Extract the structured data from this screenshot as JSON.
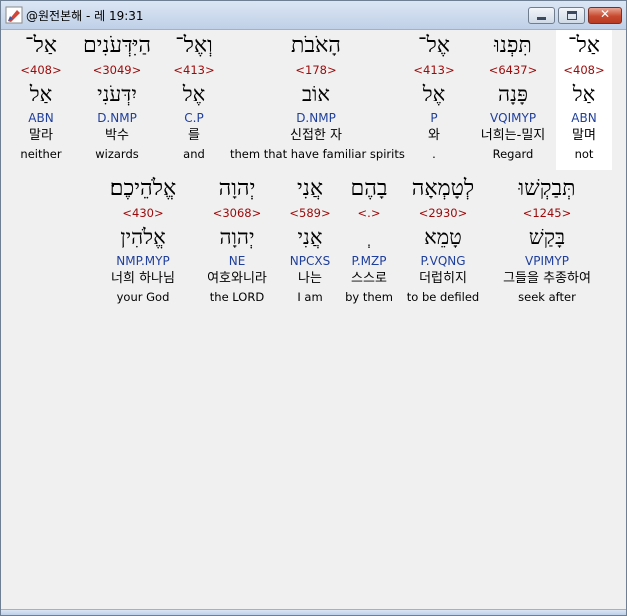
{
  "window": {
    "title": "@원전본해 - 레 19:31",
    "close_glyph": "✕"
  },
  "rows": [
    {
      "words": [
        {
          "hebrew": "אַל־",
          "strong": "<408>",
          "lemma": "אַל",
          "morph": "ABN",
          "korean": "말며",
          "english": "not",
          "highlighted": true
        },
        {
          "hebrew": "תִּפְנוּ",
          "strong": "<6437>",
          "lemma": "פָּנָה",
          "morph": "VQIMYP",
          "korean": "너희는-밀지",
          "english": "Regard",
          "highlighted": false
        },
        {
          "hebrew": "אֶל־",
          "strong": "<413>",
          "lemma": "אֶל",
          "morph": "P",
          "korean": "와",
          "english": ".",
          "highlighted": false
        },
        {
          "hebrew": "הָאֹבֹת",
          "strong": "<178>",
          "lemma": "אוֹב",
          "morph": "D.NMP",
          "korean": "신접한 자",
          "english": "them that have familiar spirits",
          "highlighted": false
        },
        {
          "hebrew": "וְאֶל־",
          "strong": "<413>",
          "lemma": "אֶל",
          "morph": "C.P",
          "korean": "를",
          "english": "and",
          "highlighted": false
        },
        {
          "hebrew": "הַיִּדְּעֹנִים",
          "strong": "<3049>",
          "lemma": "יִדְּעֹנִי",
          "morph": "D.NMP",
          "korean": "박수",
          "english": "wizards",
          "highlighted": false
        },
        {
          "hebrew": "אַל־",
          "strong": "<408>",
          "lemma": "אַל",
          "morph": "ABN",
          "korean": "말라",
          "english": "neither",
          "highlighted": false
        }
      ]
    },
    {
      "words": [
        {
          "hebrew": "תְּבַקְשׁוּ",
          "strong": "<1245>",
          "lemma": "בָּקַשׁ",
          "morph": "VPIMYP",
          "korean": "그들을 추종하여",
          "english": "seek after",
          "highlighted": false
        },
        {
          "hebrew": "לְטָמְאָה",
          "strong": "<2930>",
          "lemma": "טָמֵא",
          "morph": "P.VQNG",
          "korean": "더럽히지",
          "english": "to be defiled",
          "highlighted": false
        },
        {
          "hebrew": "בָהֶם",
          "strong": "<.>",
          "lemma": "ְ",
          "morph": "P.MZP",
          "korean": "스스로",
          "english": "by them",
          "highlighted": false
        },
        {
          "hebrew": "אֲנִי",
          "strong": "<589>",
          "lemma": "אֲנִי",
          "morph": "NPCXS",
          "korean": "나는",
          "english": "I am",
          "highlighted": false
        },
        {
          "hebrew": "יְהוָה",
          "strong": "<3068>",
          "lemma": "יְהוָה",
          "morph": "NE",
          "korean": "여호와니라",
          "english": "the LORD",
          "highlighted": false
        },
        {
          "hebrew": "אֱלֹהֵיכֶם׃",
          "strong": "<430>",
          "lemma": "אֱלֹהִין",
          "morph": "NMP.MYP",
          "korean": "너희 하나님",
          "english": "your God",
          "highlighted": false
        }
      ]
    }
  ]
}
